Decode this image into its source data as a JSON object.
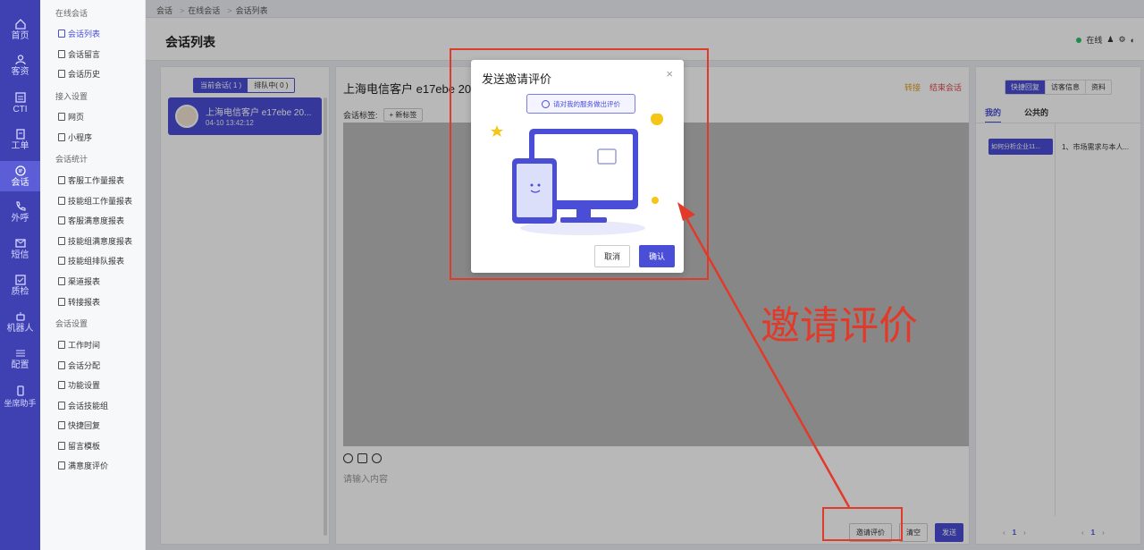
{
  "rail": {
    "items": [
      {
        "label": "首页",
        "icon": "home-icon"
      },
      {
        "label": "客资",
        "icon": "customer-icon"
      },
      {
        "label": "CTI",
        "icon": "cti-icon"
      },
      {
        "label": "工单",
        "icon": "ticket-icon"
      },
      {
        "label": "会话",
        "icon": "chat-icon"
      },
      {
        "label": "外呼",
        "icon": "phone-icon"
      },
      {
        "label": "短信",
        "icon": "sms-icon"
      },
      {
        "label": "质检",
        "icon": "quality-icon"
      },
      {
        "label": "机器人",
        "icon": "robot-icon"
      },
      {
        "label": "配置",
        "icon": "config-icon"
      },
      {
        "label": "坐席助手",
        "icon": "assistant-icon"
      }
    ]
  },
  "subnav": {
    "group1": "在线会话",
    "group1_items": [
      "会话列表",
      "会话留言",
      "会话历史"
    ],
    "group2": "接入设置",
    "group2_items": [
      "网页",
      "小程序"
    ],
    "group3": "会话统计",
    "group3_items": [
      "客服工作量报表",
      "技能组工作量报表",
      "客服满意度报表",
      "技能组满意度报表",
      "技能组排队报表",
      "渠道报表",
      "转接报表"
    ],
    "group4": "会话设置",
    "group4_items": [
      "工作时间",
      "会话分配",
      "功能设置",
      "会话技能组",
      "快捷回复",
      "留言模板",
      "满意度评价"
    ]
  },
  "breadcrumb": {
    "c1": "会话",
    "c2": "在线会话",
    "c3": "会话列表"
  },
  "header": {
    "title": "会话列表",
    "status": "在线"
  },
  "left_panel": {
    "tab_current": "当前会话( 1 )",
    "tab_queue": "排队中( 0 )",
    "session_name": "上海电信客户 e17ebe 20...",
    "session_time": "04-10 13:42:12"
  },
  "center_panel": {
    "title": "上海电信客户 e17ebe 2025",
    "transfer": "转接",
    "end": "结束会话",
    "tags_label": "会话标签:",
    "new_tag": "+ 新标签",
    "input_placeholder": "请输入内容",
    "btn_invite": "邀请评价",
    "btn_clear": "清空",
    "btn_send": "发送"
  },
  "right_panel": {
    "tab_quick": "快捷回复",
    "tab_visitor": "访客信息",
    "tab_profile": "资料",
    "sub_mine": "我的",
    "sub_public": "公共的",
    "reply_category": "如何分析企业11...",
    "reply_item": "1、市场需求与本人...",
    "page_num": "1"
  },
  "modal": {
    "title": "发送邀请评价",
    "close": "×",
    "bubble": "请对我的服务做出评价",
    "cancel": "取消",
    "confirm": "确认"
  },
  "annotation": {
    "text": "邀请评价"
  },
  "colors": {
    "brand": "#4a4ed6",
    "rail": "#3f41b3",
    "annotation": "#e23a2a"
  }
}
